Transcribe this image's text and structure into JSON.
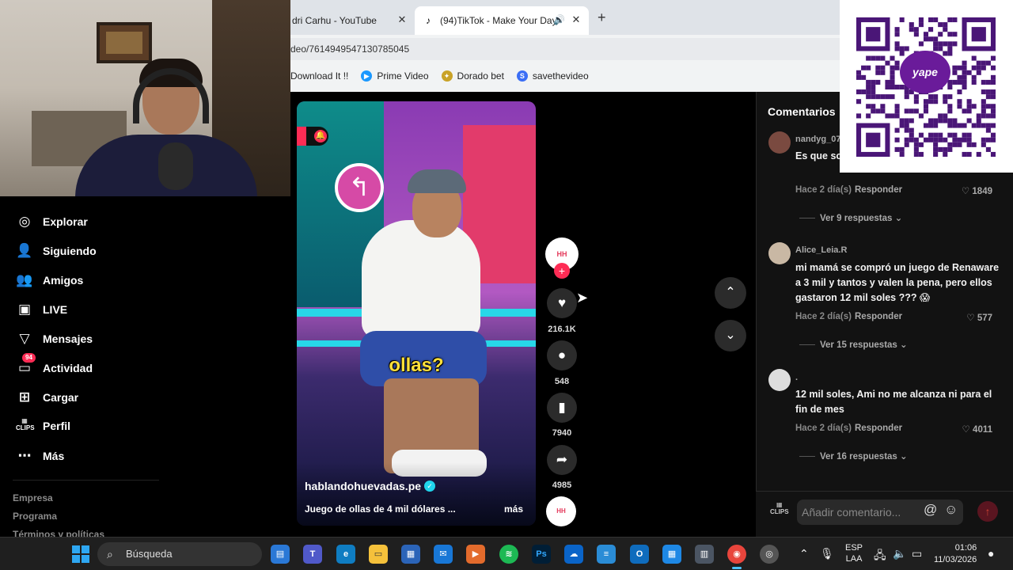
{
  "browser": {
    "tabs": [
      {
        "title": "dri Carhu - YouTube",
        "close": "✕"
      },
      {
        "title": "(94)TikTok - Make Your Day",
        "close": "✕",
        "favicon": "tiktok-icon"
      }
    ],
    "new_tab": "+",
    "url": "deo/7614949547130785045",
    "bookmarks": [
      {
        "label": "Download It !!"
      },
      {
        "label": "Prime Video",
        "icon": "prime-video-icon",
        "color": "#1a98ff"
      },
      {
        "label": "Dorado bet",
        "icon": "dorado-bet-icon",
        "color": "#c9a227"
      },
      {
        "label": "savethevideo",
        "icon": "savethevideo-icon",
        "color": "#3b6ef5"
      }
    ]
  },
  "sidebar": {
    "items": [
      {
        "label": "Explorar",
        "icon": "compass-icon"
      },
      {
        "label": "Siguiendo",
        "icon": "user-follow-icon"
      },
      {
        "label": "Amigos",
        "icon": "friends-icon"
      },
      {
        "label": "LIVE",
        "icon": "live-tv-icon"
      },
      {
        "label": "Mensajes",
        "icon": "send-icon"
      },
      {
        "label": "Actividad",
        "icon": "inbox-icon",
        "badge": "94"
      },
      {
        "label": "Cargar",
        "icon": "upload-icon"
      },
      {
        "label": "Perfil",
        "icon": "clips-icon"
      },
      {
        "label": "Más",
        "icon": "more-icon"
      }
    ],
    "footer": [
      "Empresa",
      "Programa",
      "Términos y políticas"
    ]
  },
  "video": {
    "caption_overlay": "ollas?",
    "author": "hablandohuevadas.pe",
    "description": "Juego de ollas de 4 mil dólares ...",
    "more_label": "más"
  },
  "actions": {
    "likes": "216.1K",
    "comments": "548",
    "saves": "7940",
    "shares": "4985"
  },
  "comments_panel": {
    "title": "Comentarios",
    "items": [
      {
        "user": "nandyg_07",
        "text": "Es que so pues 😁",
        "meta": "Hace 2 día(s)",
        "reply": "Responder",
        "likes": "1849",
        "more": "Ver 9 respuestas"
      },
      {
        "user": "Alice_Leia.R",
        "text": "mi mamá se compró un juego de Renaware a 3 mil y tantos y valen la pena, pero ellos gastaron 12 mil soles ??? 😱",
        "meta": "Hace 2 día(s)",
        "reply": "Responder",
        "likes": "577",
        "more": "Ver 15 respuestas"
      },
      {
        "user": ".",
        "text": "12 mil soles, Ami no me alcanza ni para el fin de mes",
        "meta": "Hace 2 día(s)",
        "reply": "Responder",
        "likes": "4011",
        "more": "Ver 16 respuestas"
      }
    ],
    "input_placeholder": "Añadir comentario...",
    "at_symbol": "@",
    "emoji_symbol": "☺",
    "clips_label": "CLIPS"
  },
  "qr": {
    "logo_text": "yape"
  },
  "taskbar": {
    "search_label": "Búsqueda",
    "lang_top": "ESP",
    "lang_bottom": "LAA",
    "time": "01:06",
    "date": "11/03/2026"
  }
}
